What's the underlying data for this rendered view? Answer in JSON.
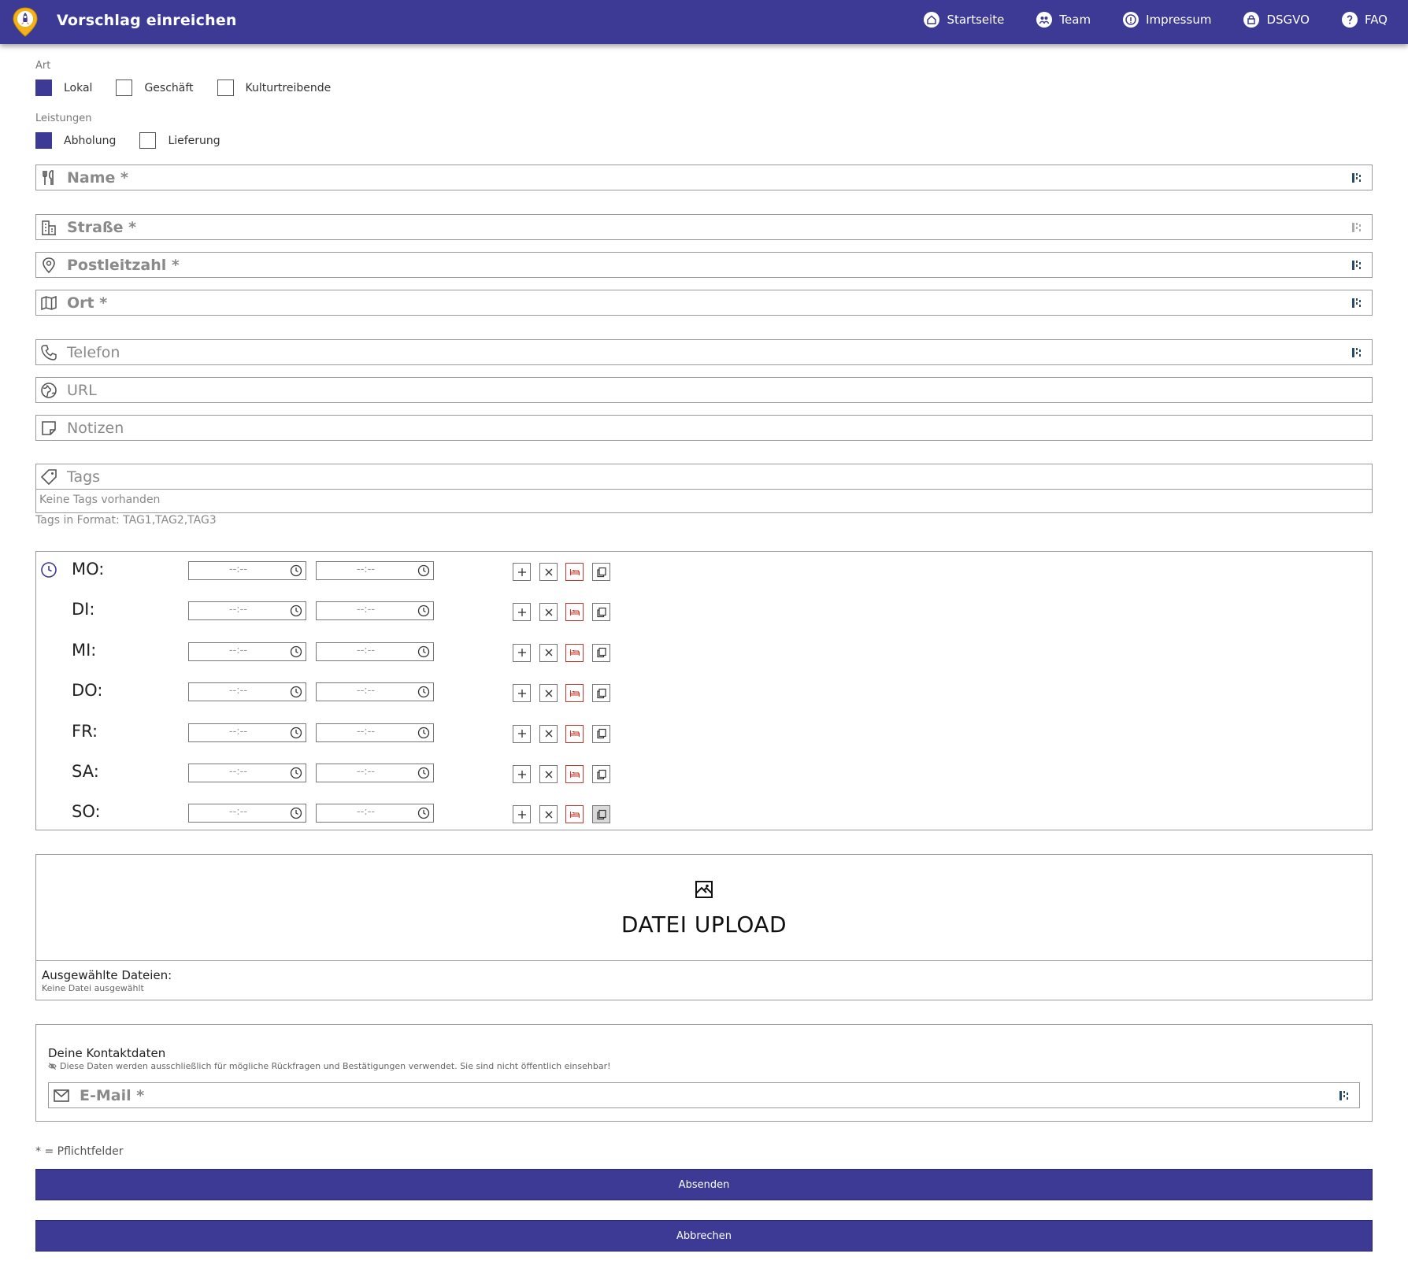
{
  "header": {
    "title": "Vorschlag einreichen",
    "logo_icon": "rocket-pin-logo",
    "nav": [
      {
        "label": "Startseite",
        "icon": "home-icon"
      },
      {
        "label": "Team",
        "icon": "team-icon"
      },
      {
        "label": "Impressum",
        "icon": "info-icon"
      },
      {
        "label": "DSGVO",
        "icon": "lock-icon"
      },
      {
        "label": "FAQ",
        "icon": "question-icon"
      }
    ],
    "bg_color": "#3c3a94"
  },
  "art": {
    "label": "Art",
    "options": [
      {
        "label": "Lokal",
        "checked": true
      },
      {
        "label": "Geschäft",
        "checked": false
      },
      {
        "label": "Kulturtreibende",
        "checked": false
      }
    ]
  },
  "leistungen": {
    "label": "Leistungen",
    "options": [
      {
        "label": "Abholung",
        "checked": true
      },
      {
        "label": "Lieferung",
        "checked": false
      }
    ]
  },
  "fields": {
    "name": {
      "placeholder": "Name *",
      "icon": "utensils-icon"
    },
    "strasse": {
      "placeholder": "Straße *",
      "icon": "building-icon"
    },
    "plz": {
      "placeholder": "Postleitzahl *",
      "icon": "map-pin-icon"
    },
    "ort": {
      "placeholder": "Ort *",
      "icon": "map-icon"
    },
    "telefon": {
      "placeholder": "Telefon",
      "icon": "phone-icon"
    },
    "url": {
      "placeholder": "URL",
      "icon": "globe-icon"
    },
    "notizen": {
      "placeholder": "Notizen",
      "icon": "note-icon"
    },
    "tags": {
      "placeholder": "Tags",
      "icon": "tag-icon",
      "empty_text": "Keine Tags vorhanden",
      "hint": "Tags in Format: TAG1,TAG2,TAG3"
    }
  },
  "hours": {
    "icon": "clock-icon",
    "time_placeholder": "--:--",
    "days": [
      {
        "label": "MO:"
      },
      {
        "label": "DI:"
      },
      {
        "label": "MI:"
      },
      {
        "label": "DO:"
      },
      {
        "label": "FR:"
      },
      {
        "label": "SA:"
      },
      {
        "label": "SO:"
      }
    ],
    "actions": [
      "plus-icon",
      "close-icon",
      "bed-icon",
      "copy-icon"
    ]
  },
  "upload": {
    "label": "DATEI UPLOAD",
    "icon": "image-icon",
    "selected_title": "Ausgewählte Dateien:",
    "selected_none": "Keine Datei ausgewählt"
  },
  "contact": {
    "title": "Deine Kontaktdaten",
    "note": "Diese Daten werden ausschließlich für mögliche Rückfragen und Bestätigungen verwendet. Sie sind nicht öffentlich einsehbar!",
    "email_placeholder": "E-Mail *",
    "note_icon": "eye-off-icon",
    "email_icon": "mail-icon"
  },
  "footer": {
    "required_note": "* = Pflichtfelder",
    "submit_label": "Absenden",
    "cancel_label": "Abbrechen"
  }
}
